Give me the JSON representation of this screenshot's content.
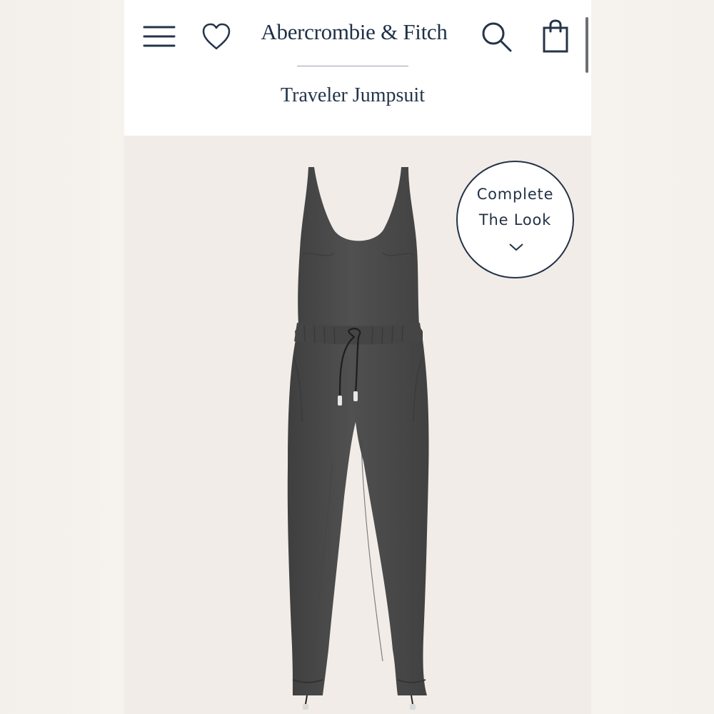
{
  "header": {
    "brand": "Abercrombie & Fitch",
    "product_title": "Traveler Jumpsuit"
  },
  "icons": {
    "menu": "hamburger-menu-icon",
    "wishlist": "heart-icon",
    "search": "search-icon",
    "bag": "shopping-bag-icon"
  },
  "product": {
    "image_alt": "Traveler Jumpsuit",
    "complete_look_line1": "Complete",
    "complete_look_line2": "The Look"
  },
  "colors": {
    "navy": "#1f3047",
    "garment": "#4b4b4b",
    "background": "#f1ece8"
  }
}
